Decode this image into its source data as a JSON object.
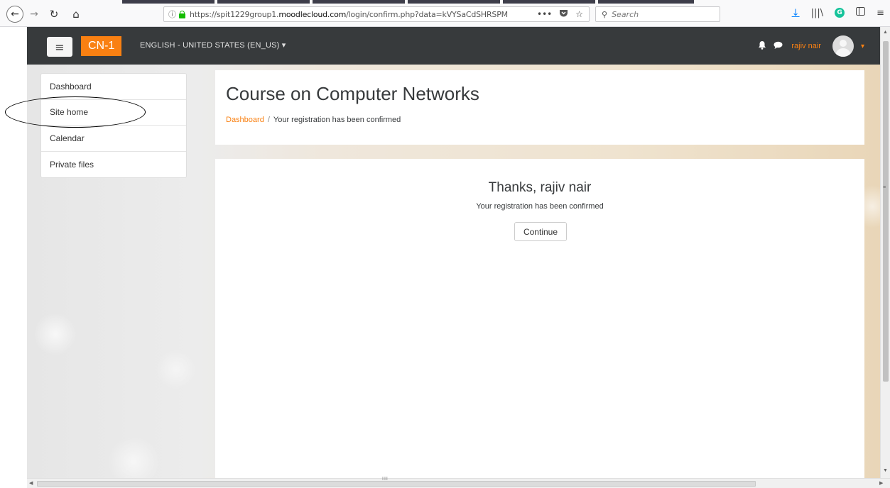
{
  "browser": {
    "url_prefix": "https://spit1229group1.",
    "url_domain": "moodlecloud.com",
    "url_path": "/login/confirm.php?data=kVYSaCdSHRSPM",
    "more_actions": "•••",
    "search_placeholder": "Search",
    "icons": {
      "back": "back-arrow-icon",
      "forward": "forward-arrow-icon",
      "reload": "reload-icon",
      "home": "home-icon",
      "info": "info-icon",
      "lock": "lock-icon",
      "pocket": "pocket-icon",
      "bookmark": "star-icon",
      "downloads": "download-icon",
      "library": "library-icon",
      "grammarly": "grammarly-icon",
      "sidebar": "sidebar-icon",
      "menu": "hamburger-icon"
    }
  },
  "navbar": {
    "brand": "CN-1",
    "language": "ENGLISH - UNITED STATES (EN_US)",
    "language_caret": "▾",
    "user_name": "rajiv nair",
    "user_caret": "▾",
    "colors": {
      "bar": "#373a3c",
      "brand": "#f98012"
    }
  },
  "drawer": {
    "items": [
      {
        "label": "Dashboard"
      },
      {
        "label": "Site home"
      },
      {
        "label": "Calendar"
      },
      {
        "label": "Private files"
      }
    ]
  },
  "header": {
    "title": "Course on Computer Networks",
    "breadcrumb_link": "Dashboard",
    "breadcrumb_sep": "/",
    "breadcrumb_current": "Your registration has been confirmed"
  },
  "main": {
    "heading": "Thanks, rajiv nair",
    "message": "Your registration has been confirmed",
    "continue_label": "Continue"
  },
  "scrollbar": {
    "grip": "III"
  }
}
